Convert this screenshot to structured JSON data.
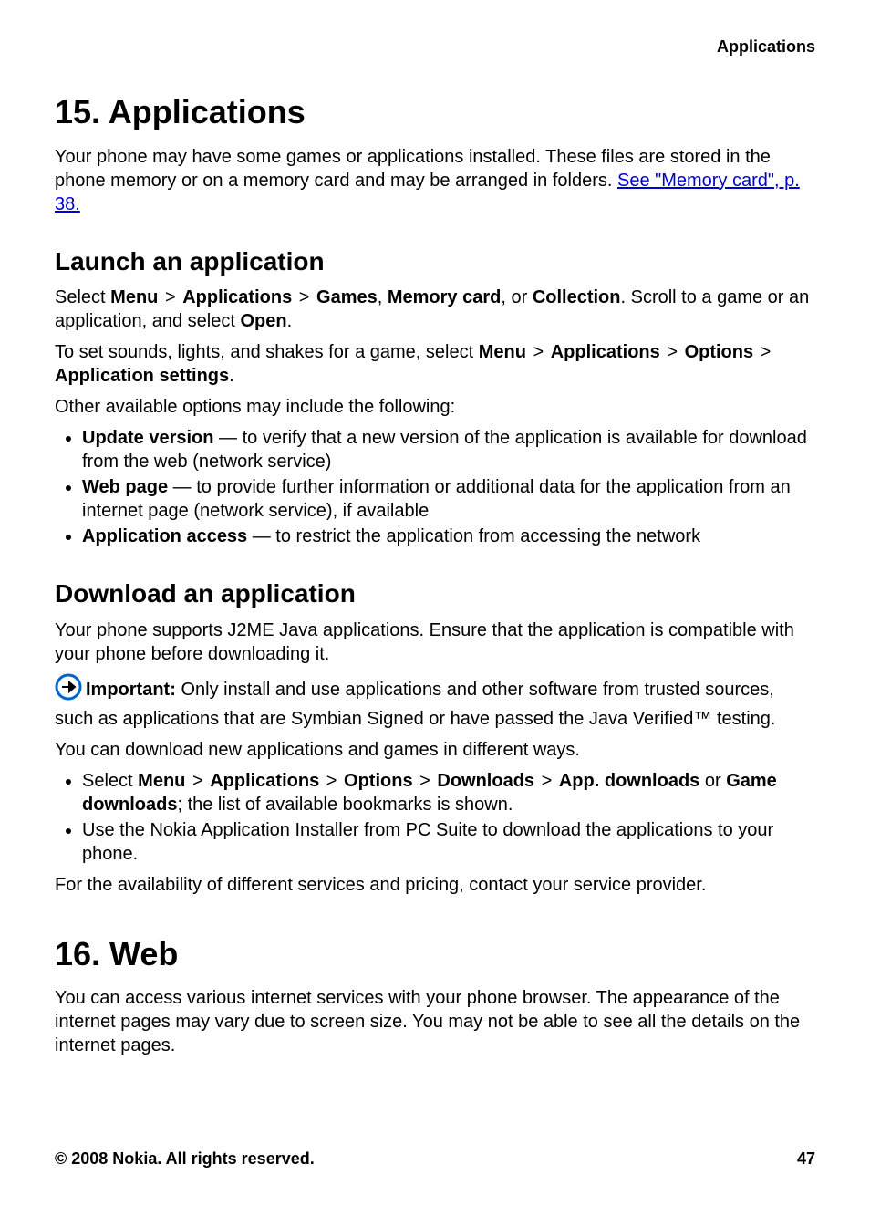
{
  "header": {
    "section": "Applications"
  },
  "ch15": {
    "title": "15.   Applications",
    "intro_a": "Your phone may have some games or applications installed. These files are stored in the phone memory or on a memory card and may be arranged in folders. ",
    "link": "See \"Memory card\", p. 38.",
    "launch": {
      "heading": "Launch an application",
      "p1_a": "Select ",
      "menu": "Menu",
      "gt": ">",
      "apps": "Applications",
      "games": "Games",
      "memcard": "Memory card",
      "collection": "Collection",
      "or": ", or ",
      "p1_b": ". Scroll to a game or an application, and select ",
      "open": "Open",
      "period": ".",
      "p2_a": "To set sounds, lights, and shakes for a game, select ",
      "options": "Options",
      "appsettings": "Application settings",
      "p3": "Other available options may include the following:",
      "li1_b": "Update version",
      "li1_t": "  — to verify that a new version of the application is available for download from the web (network service)",
      "li2_b": "Web page",
      "li2_t": " —  to provide further information or additional data for the application from an internet page (network service), if available",
      "li3_b": "Application access",
      "li3_t": " —  to restrict the application from accessing the network"
    },
    "download": {
      "heading": "Download an application",
      "p1": "Your phone supports J2ME Java applications. Ensure that the application is compatible with your phone before downloading it.",
      "imp_label": "Important:",
      "imp_text": " Only install and use applications and other software from trusted sources, such as applications that are Symbian Signed or have passed the Java Verified™ testing.",
      "p2": "You can download new applications and games in different ways.",
      "li1_a": "Select ",
      "downloads": "Downloads",
      "appdl": "App. downloads",
      "gamedl": "Game downloads",
      "li1_b": "; the list of available bookmarks is shown.",
      "or_word": " or ",
      "li2": "Use the Nokia Application Installer from PC Suite to download the applications to your phone.",
      "p3": "For the availability of different services and pricing, contact your service provider."
    }
  },
  "ch16": {
    "title": "16.    Web",
    "p1": "You can access various internet services with your phone browser. The appearance of the internet pages may vary due to screen size. You may not be able to see all the details on the internet pages."
  },
  "footer": {
    "copyright": "© 2008 Nokia. All rights reserved.",
    "page": "47"
  }
}
